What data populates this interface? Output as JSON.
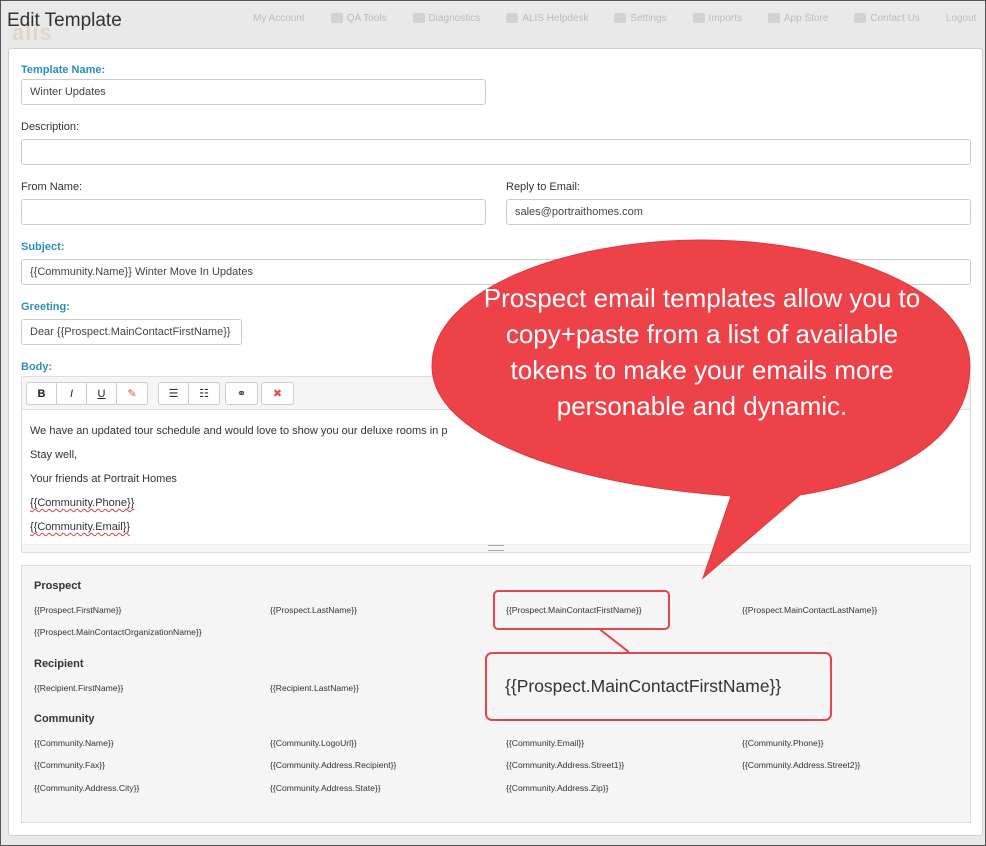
{
  "page": {
    "title": "Edit Template"
  },
  "background_nav": {
    "items": [
      "My Account",
      "QA Tools",
      "Diagnostics",
      "ALIS Helpdesk",
      "Settings",
      "Imports",
      "App Store",
      "Contact Us",
      "Logout"
    ]
  },
  "form": {
    "template_name": {
      "label": "Template Name:",
      "value": "Winter Updates"
    },
    "description": {
      "label": "Description:",
      "value": ""
    },
    "from_name": {
      "label": "From Name:",
      "value": ""
    },
    "reply_to": {
      "label": "Reply to Email:",
      "value": "sales@portraithomes.com"
    },
    "subject": {
      "label": "Subject:",
      "value": "{{Community.Name}} Winter Move In Updates"
    },
    "greeting": {
      "label": "Greeting:",
      "value": "Dear {{Prospect.MainContactFirstName}}"
    },
    "body": {
      "label": "Body:",
      "toolbar": {
        "bold": "B",
        "italic": "I",
        "underline": "U",
        "eraser": "✎",
        "ul": "☰",
        "ol": "☷",
        "link": "⚭",
        "remove": "✖"
      },
      "lines": [
        "We have an updated tour schedule and would love to show you our deluxe rooms in p",
        "Stay well,",
        "Your friends at Portrait Homes",
        "{{Community.Phone}}",
        "{{Community.Email}}"
      ]
    }
  },
  "tokens": {
    "prospect": {
      "title": "Prospect",
      "items": [
        "{{Prospect.FirstName}}",
        "{{Prospect.LastName}}",
        "{{Prospect.MainContactFirstName}}",
        "{{Prospect.MainContactLastName}}",
        "{{Prospect.MainContactOrganizationName}}"
      ]
    },
    "recipient": {
      "title": "Recipient",
      "items": [
        "{{Recipient.FirstName}}",
        "{{Recipient.LastName}}"
      ]
    },
    "community": {
      "title": "Community",
      "items": [
        "{{Community.Name}}",
        "{{Community.LogoUrl}}",
        "{{Community.Email}}",
        "{{Community.Phone}}",
        "{{Community.Fax}}",
        "{{Community.Address.Recipient}}",
        "{{Community.Address.Street1}}",
        "{{Community.Address.Street2}}",
        "{{Community.Address.City}}",
        "{{Community.Address.State}}",
        "{{Community.Address.Zip}}"
      ]
    }
  },
  "callout": {
    "text": "Prospect email templates allow you to copy+paste from a list of available tokens to make your emails more personable and dynamic.",
    "zoom_token": "{{Prospect.MainContactFirstName}}",
    "color": "#ee4249"
  }
}
